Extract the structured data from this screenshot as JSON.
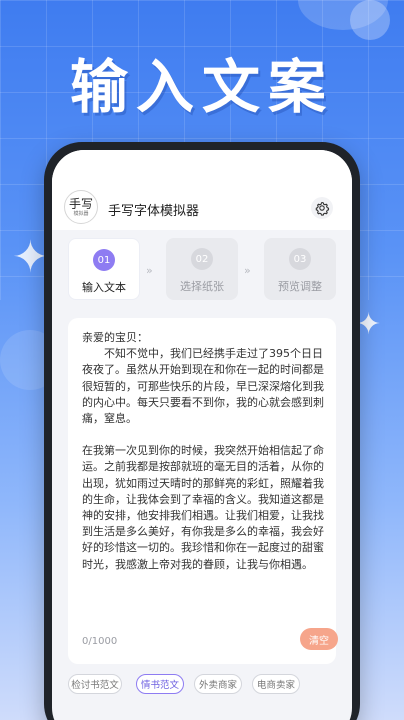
{
  "banner": {
    "title": "输入文案"
  },
  "app": {
    "title": "手写字体模拟器",
    "logo_text": "手写",
    "logo_sub": "模拟器"
  },
  "steps": [
    {
      "num": "01",
      "label": "输入文本",
      "active": true
    },
    {
      "num": "02",
      "label": "选择纸张",
      "active": false
    },
    {
      "num": "03",
      "label": "预览调整",
      "active": false
    }
  ],
  "editor": {
    "greeting": "亲爱的宝贝：",
    "para1": "不知不觉中，我们已经携手走过了395个日日夜夜了。虽然从开始到现在和你在一起的时间都是很短暂的，可那些快乐的片段，早已深深熔化到我的内心中。每天只要看不到你，我的心就会感到刺痛，窒息。",
    "para2": "在我第一次见到你的时候，我突然开始相信起了命运。之前我都是按部就班的毫无目的活着，从你的出现，犹如雨过天晴时的那鲜亮的彩虹，照耀着我的生命，让我体会到了幸福的含义。我知道这都是神的安排，他安排我们相遇。让我们相爱，让我找到生活是多么美好，有你我是多么的幸福，我会好好的珍惜这一切的。我珍惜和你在一起度过的甜蜜时光，我感激上帝对我的眷顾，让我与你相遇。",
    "char_count": "0/1000",
    "clear_label": "清空"
  },
  "templates": [
    {
      "label": "检讨书范文",
      "selected": false
    },
    {
      "label": "情书范文",
      "selected": true
    },
    {
      "label": "外卖商家",
      "selected": false
    },
    {
      "label": "电商卖家",
      "selected": false
    }
  ],
  "colors": {
    "accent": "#8e7cf2",
    "clear_button": "#f6a58b",
    "background_top": "#3f7cf0"
  }
}
